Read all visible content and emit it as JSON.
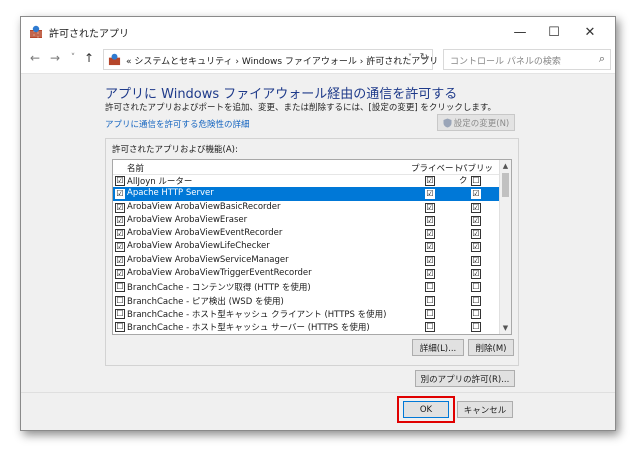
{
  "window": {
    "title": "許可されたアプリ",
    "controls": {
      "minimize": "—",
      "maximize": "☐",
      "close": "✕"
    }
  },
  "addressbar": {
    "back": "←",
    "forward": "→",
    "history": "˅",
    "up": "↑",
    "breadcrumb": "« システムとセキュリティ › Windows ファイアウォール › 許可されたアプリ",
    "dropdown": "˅",
    "refresh": "↻",
    "search_placeholder": "コントロール パネルの検索",
    "search_icon": "⌕"
  },
  "content": {
    "title": "アプリに Windows ファイアウォール経由の通信を許可する",
    "description": "許可されたアプリおよびポートを追加、変更、または削除するには、[設定の変更] をクリックします。",
    "risk_link": "アプリに通信を許可する危険性の詳細",
    "change_settings": "設定の変更(N)",
    "group_label": "許可されたアプリおよび機能(A):",
    "columns": {
      "name": "名前",
      "private": "プライベート",
      "public": "パブリック"
    },
    "apps": [
      {
        "name": "AllJoyn ルーター",
        "enabled": "☑",
        "private": "☑",
        "public": "☐"
      },
      {
        "name": "Apache HTTP Server",
        "enabled": "☑",
        "private": "☑",
        "public": "☑"
      },
      {
        "name": "ArobaView ArobaViewBasicRecorder",
        "enabled": "☑",
        "private": "☑",
        "public": "☑"
      },
      {
        "name": "ArobaView ArobaViewEraser",
        "enabled": "☑",
        "private": "☑",
        "public": "☑"
      },
      {
        "name": "ArobaView ArobaViewEventRecorder",
        "enabled": "☑",
        "private": "☑",
        "public": "☑"
      },
      {
        "name": "ArobaView ArobaViewLifeChecker",
        "enabled": "☑",
        "private": "☑",
        "public": "☑"
      },
      {
        "name": "ArobaView ArobaViewServiceManager",
        "enabled": "☑",
        "private": "☑",
        "public": "☑"
      },
      {
        "name": "ArobaView ArobaViewTriggerEventRecorder",
        "enabled": "☑",
        "private": "☑",
        "public": "☑"
      },
      {
        "name": "BranchCache - コンテンツ取得 (HTTP を使用)",
        "enabled": "☐",
        "private": "☐",
        "public": "☐"
      },
      {
        "name": "BranchCache - ピア検出 (WSD を使用)",
        "enabled": "☐",
        "private": "☐",
        "public": "☐"
      },
      {
        "name": "BranchCache - ホスト型キャッシュ クライアント (HTTPS を使用)",
        "enabled": "☐",
        "private": "☐",
        "public": "☐"
      },
      {
        "name": "BranchCache - ホスト型キャッシュ サーバー (HTTPS を使用)",
        "enabled": "☐",
        "private": "☐",
        "public": "☐"
      }
    ],
    "selected_app": "Apache HTTP Server",
    "details_button": "詳細(L)...",
    "remove_button": "削除(M)",
    "allow_other_button": "別のアプリの許可(R)..."
  },
  "footer": {
    "ok": "OK",
    "cancel": "キャンセル"
  },
  "colors": {
    "selection": "#0078d7",
    "highlight_box": "#e00000",
    "title_blue": "#1e3a8a",
    "link": "#1565c0"
  }
}
